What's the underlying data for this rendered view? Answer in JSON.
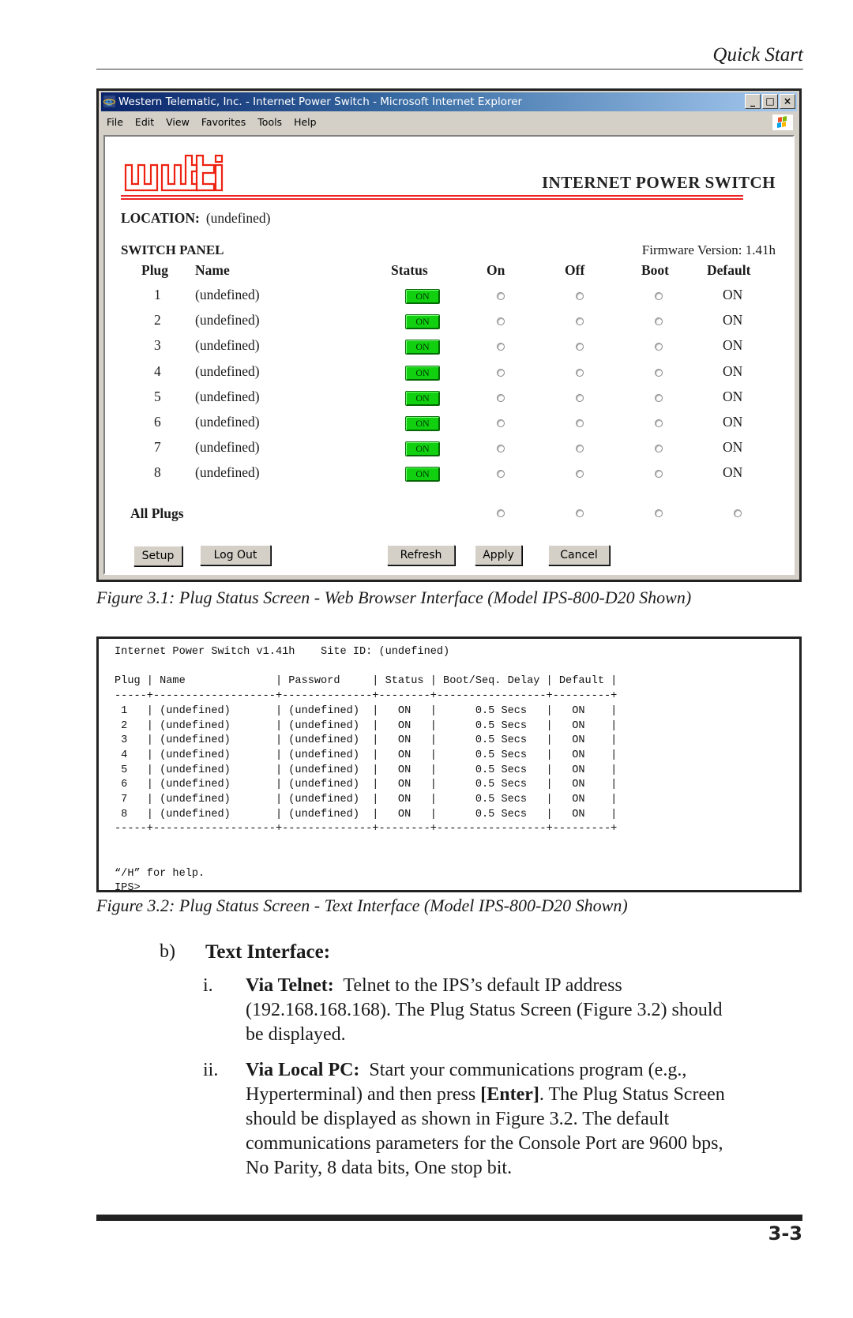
{
  "page_header": "Quick Start",
  "browser": {
    "window_title": "Western Telematic, Inc. - Internet Power Switch - Microsoft Internet Explorer",
    "window_buttons": [
      "_",
      "□",
      "×"
    ],
    "menu": [
      "File",
      "Edit",
      "View",
      "Favorites",
      "Tools",
      "Help"
    ],
    "logo_text": "wti",
    "product_title": "INTERNET POWER SWITCH",
    "location_label": "LOCATION:",
    "location_value": "(undefined)",
    "switch_panel_label": "SWITCH PANEL",
    "firmware": "Firmware Version: 1.41h",
    "columns": [
      "Plug",
      "Name",
      "Status",
      "On",
      "Off",
      "Boot",
      "Default"
    ],
    "rows": [
      {
        "plug": "1",
        "name": "(undefined)",
        "status": "ON",
        "default": "ON"
      },
      {
        "plug": "2",
        "name": "(undefined)",
        "status": "ON",
        "default": "ON"
      },
      {
        "plug": "3",
        "name": "(undefined)",
        "status": "ON",
        "default": "ON"
      },
      {
        "plug": "4",
        "name": "(undefined)",
        "status": "ON",
        "default": "ON"
      },
      {
        "plug": "5",
        "name": "(undefined)",
        "status": "ON",
        "default": "ON"
      },
      {
        "plug": "6",
        "name": "(undefined)",
        "status": "ON",
        "default": "ON"
      },
      {
        "plug": "7",
        "name": "(undefined)",
        "status": "ON",
        "default": "ON"
      },
      {
        "plug": "8",
        "name": "(undefined)",
        "status": "ON",
        "default": "ON"
      }
    ],
    "all_plugs_label": "All Plugs",
    "buttons": {
      "setup": "Setup",
      "logout": "Log Out",
      "refresh": "Refresh",
      "apply": "Apply",
      "cancel": "Cancel"
    },
    "status_on_color": "#10d010"
  },
  "figure1_caption": "Figure 3.1:  Plug Status Screen - Web Browser Interface (Model IPS-800-D20 Shown)",
  "console": {
    "lines": [
      "Internet Power Switch v1.41h    Site ID: (undefined)",
      "",
      "Plug | Name              | Password     | Status | Boot/Seq. Delay | Default |",
      "-----+-------------------+--------------+--------+-----------------+---------+",
      " 1   | (undefined)       | (undefined)  |   ON   |      0.5 Secs   |   ON    |",
      " 2   | (undefined)       | (undefined)  |   ON   |      0.5 Secs   |   ON    |",
      " 3   | (undefined)       | (undefined)  |   ON   |      0.5 Secs   |   ON    |",
      " 4   | (undefined)       | (undefined)  |   ON   |      0.5 Secs   |   ON    |",
      " 5   | (undefined)       | (undefined)  |   ON   |      0.5 Secs   |   ON    |",
      " 6   | (undefined)       | (undefined)  |   ON   |      0.5 Secs   |   ON    |",
      " 7   | (undefined)       | (undefined)  |   ON   |      0.5 Secs   |   ON    |",
      " 8   | (undefined)       | (undefined)  |   ON   |      0.5 Secs   |   ON    |",
      "-----+-------------------+--------------+--------+-----------------+---------+",
      "",
      "",
      "“/H” for help.",
      "IPS>"
    ]
  },
  "figure2_caption": "Figure 3.2:  Plug Status Screen - Text Interface (Model IPS-800-D20 Shown)",
  "section": {
    "marker": "b)",
    "title": "Text Interface:",
    "items": [
      {
        "marker": "i.",
        "lead": "Via Telnet:",
        "lines": [
          "Telnet to the IPS’s default IP address",
          "(192.168.168.168).  The Plug Status Screen (Figure 3.2) should",
          "be displayed."
        ]
      },
      {
        "marker": "ii.",
        "lead": "Via Local PC:",
        "line1": "Start your communications program (e.g.,",
        "line2_a": "Hyperterminal) and then press ",
        "line2_b": "[Enter]",
        "line2_c": ".  The Plug Status Screen",
        "line3": "should be displayed as shown in Figure 3.2.  The default",
        "line4": "communications parameters for the Console Port are 9600 bps,",
        "line5": "No Parity, 8 data bits, One stop bit."
      }
    ]
  },
  "page_number": "3-3"
}
